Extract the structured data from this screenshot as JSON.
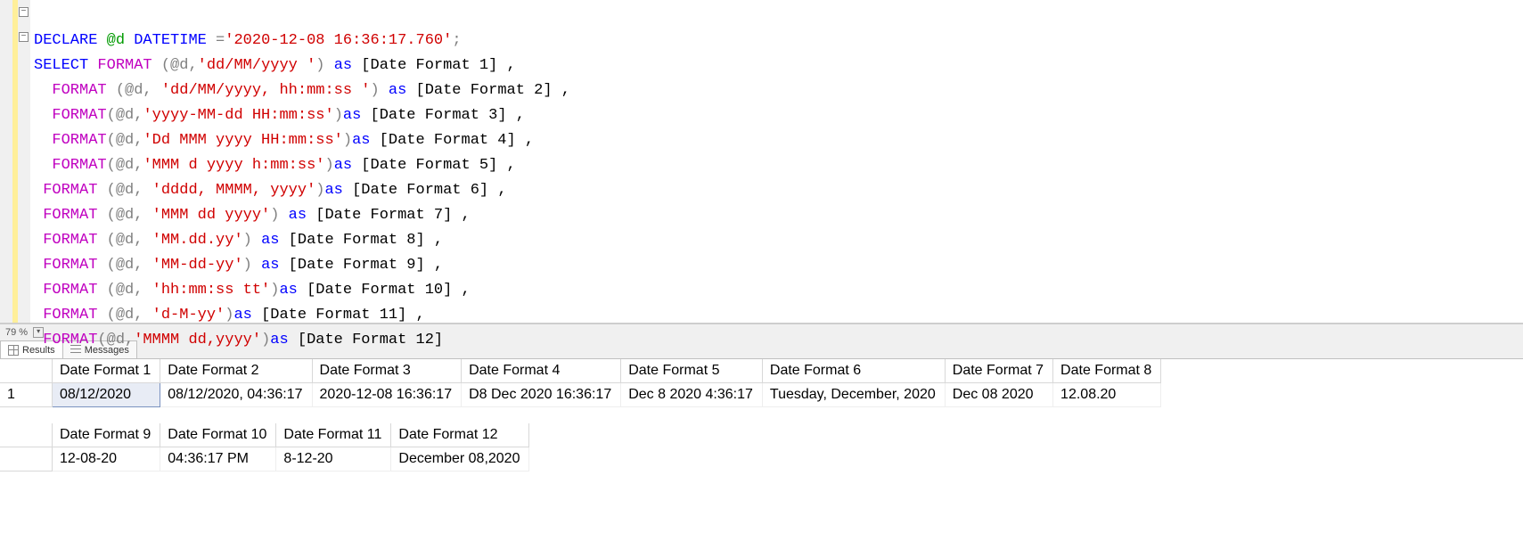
{
  "zoom": "79 %",
  "tabs": {
    "results": "Results",
    "messages": "Messages"
  },
  "code": {
    "l1": {
      "a": "DECLARE",
      "b": " @d ",
      "c": "DATETIME",
      "d": " =",
      "e": "'2020-12-08 16:36:17.760'",
      "f": ";"
    },
    "l2": {
      "a": "SELECT",
      "b": " ",
      "c": "FORMAT",
      "d": " (@d,",
      "e": "'dd/MM/yyyy '",
      "f": ") ",
      "g": "as",
      "h": " [Date Format 1] ,"
    },
    "l3": {
      "c": "FORMAT",
      "d": " (@d, ",
      "e": "'dd/MM/yyyy, hh:mm:ss '",
      "f": ") ",
      "g": "as",
      "h": " [Date Format 2] ,"
    },
    "l4": {
      "c": "FORMAT",
      "d": "(@d,",
      "e": "'yyyy-MM-dd HH:mm:ss'",
      "f": ")",
      "g": "as",
      "h": " [Date Format 3] ,"
    },
    "l5": {
      "c": "FORMAT",
      "d": "(@d,",
      "e": "'Dd MMM yyyy HH:mm:ss'",
      "f": ")",
      "g": "as",
      "h": " [Date Format 4] ,"
    },
    "l6": {
      "c": "FORMAT",
      "d": "(@d,",
      "e": "'MMM d yyyy h:mm:ss'",
      "f": ")",
      "g": "as",
      "h": " [Date Format 5] ,"
    },
    "l7": {
      "c": "FORMAT",
      "d": " (@d, ",
      "e": "'dddd, MMMM, yyyy'",
      "f": ")",
      "g": "as",
      "h": " [Date Format 6] ,"
    },
    "l8": {
      "c": "FORMAT",
      "d": " (@d, ",
      "e": "'MMM dd yyyy'",
      "f": ") ",
      "g": "as",
      "h": " [Date Format 7] ,"
    },
    "l9": {
      "c": "FORMAT",
      "d": " (@d, ",
      "e": "'MM.dd.yy'",
      "f": ") ",
      "g": "as",
      "h": " [Date Format 8] ,"
    },
    "l10": {
      "c": "FORMAT",
      "d": " (@d, ",
      "e": "'MM-dd-yy'",
      "f": ") ",
      "g": "as",
      "h": " [Date Format 9] ,"
    },
    "l11": {
      "c": "FORMAT",
      "d": " (@d, ",
      "e": "'hh:mm:ss tt'",
      "f": ")",
      "g": "as",
      "h": " [Date Format 10] ,"
    },
    "l12": {
      "c": "FORMAT",
      "d": " (@d, ",
      "e": "'d-M-yy'",
      "f": ")",
      "g": "as",
      "h": " [Date Format 11] ,"
    },
    "l13": {
      "c": "FORMAT",
      "d": "(@d,",
      "e": "'MMMM dd,yyyy'",
      "f": ")",
      "g": "as",
      "h": " [Date Format 12]"
    }
  },
  "table1": {
    "rownum": "1",
    "headers": [
      "Date Format 1",
      "Date Format 2",
      "Date Format 3",
      "Date Format 4",
      "Date Format 5",
      "Date Format 6",
      "Date Format 7",
      "Date Format 8"
    ],
    "row": [
      "08/12/2020",
      "08/12/2020, 04:36:17",
      "2020-12-08 16:36:17",
      "D8 Dec 2020 16:36:17",
      "Dec 8 2020 4:36:17",
      "Tuesday, December, 2020",
      "Dec 08 2020",
      "12.08.20"
    ]
  },
  "table2": {
    "headers": [
      "Date Format 9",
      "Date Format 10",
      "Date Format 11",
      "Date Format 12"
    ],
    "row": [
      "12-08-20",
      "04:36:17 PM",
      "8-12-20",
      "December 08,2020"
    ]
  }
}
